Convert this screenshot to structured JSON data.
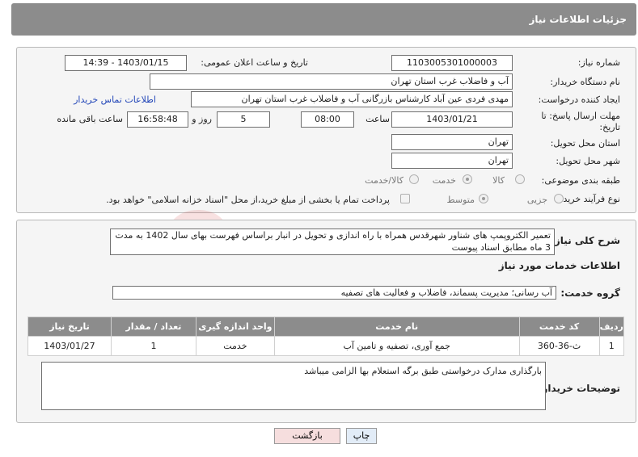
{
  "header": {
    "title": "جزئیات اطلاعات نیاز"
  },
  "labels": {
    "need_number": "شماره نیاز:",
    "announce_datetime": "تاریخ و ساعت اعلان عمومی:",
    "buyer_org": "نام دستگاه خریدار:",
    "creator": "ایجاد کننده درخواست:",
    "deadline": "مهلت ارسال پاسخ: تا تاریخ:",
    "time_word": "ساعت",
    "days_word": "روز و",
    "remaining_word": "ساعت باقی مانده",
    "province": "استان محل تحویل:",
    "city": "شهر محل تحویل:",
    "category": "طبقه بندی موضوعی:",
    "process_type": "نوع فرآیند خرید :",
    "description": "شرح کلی نیاز:",
    "services_info": "اطلاعات خدمات مورد نیاز",
    "service_group": "گروه خدمت:",
    "buyer_notes": "توضیحات خریدار:"
  },
  "values": {
    "need_number": "1103005301000003",
    "announce_datetime": "1403/01/15 - 14:39",
    "buyer_org": "آب و فاضلاب غرب استان تهران",
    "creator": "مهدی فردی عین آباد کارشناس بازرگانی آب و فاضلاب غرب استان تهران",
    "contact_link": "اطلاعات تماس خریدار",
    "deadline_date": "1403/01/21",
    "deadline_time": "08:00",
    "days": "5",
    "remaining_time": "16:58:48",
    "province": "تهران",
    "city": "تهران",
    "description": "تعمیر الکتروپمپ های شناور شهرقدس همراه با راه اندازی و تحویل در انبار براساس فهرست بهای سال 1402 به مدت 3 ماه مطابق اسناد پیوست",
    "service_group": "آب رسانی؛ مدیریت پسماند، فاضلاب و فعالیت های تصفیه",
    "buyer_notes": "بارگذاری مدارک درخواستی طبق برگه استعلام بها الزامی میباشد"
  },
  "category_options": {
    "goods": "کالا",
    "service": "خدمت",
    "goods_service": "کالا/خدمت",
    "selected": "service"
  },
  "process_options": {
    "partial": "جزیی",
    "medium": "متوسط",
    "selected": "medium",
    "treasury_note": "پرداخت تمام یا بخشی از مبلغ خرید،از محل \"اسناد خزانه اسلامی\" خواهد بود."
  },
  "table": {
    "headers": [
      "ردیف",
      "کد خدمت",
      "نام خدمت",
      "واحد اندازه گیری",
      "تعداد / مقدار",
      "تاریخ نیاز"
    ],
    "rows": [
      [
        "1",
        "ث-36-360",
        "جمع آوری، تصفیه و تامین آب",
        "خدمت",
        "1",
        "1403/01/27"
      ]
    ]
  },
  "buttons": {
    "print": "چاپ",
    "back": "بازگشت"
  },
  "watermark": "AriaTender.neT",
  "colors": {
    "header_bg": "#8c8c8c",
    "link": "#2246b8",
    "back_button_bg": "#f6dede",
    "print_button_bg": "#e2ecf7"
  }
}
